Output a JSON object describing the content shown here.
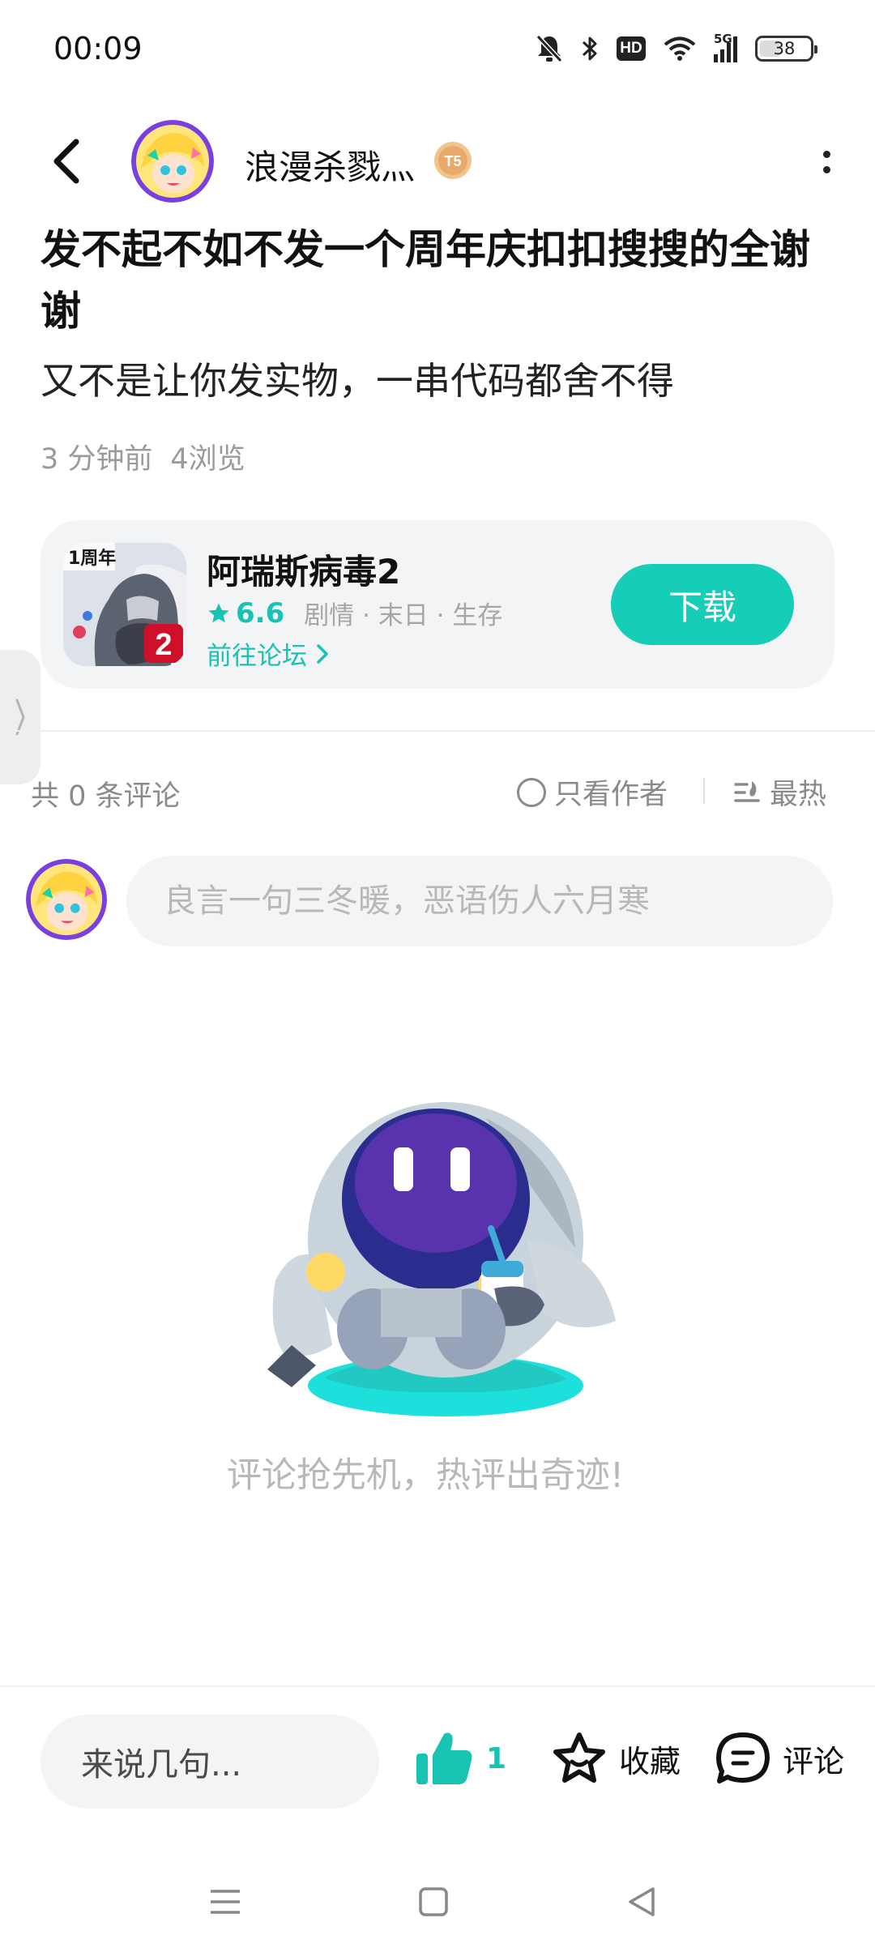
{
  "status_bar": {
    "time": "00:09",
    "hd_label": "HD",
    "network_label": "5G",
    "battery": "38"
  },
  "header": {
    "author_name": "浪漫杀戮灬",
    "level_badge": "T5"
  },
  "post": {
    "title": "发不起不如不发一个周年庆扣扣搜搜的全谢谢",
    "body": "又不是让你发实物，一串代码都舍不得",
    "time_ago": "3 分钟前",
    "views": "4浏览"
  },
  "game_card": {
    "name": "阿瑞斯病毒2",
    "rating": "6.6",
    "tags": "剧情 · 末日 · 生存",
    "forum_link": "前往论坛",
    "download_label": "下载",
    "icon_badge_text": "1周年",
    "icon_number": "2"
  },
  "comments": {
    "count_label": "共 0 条评论",
    "author_only_label": "只看作者",
    "sort_label": "最热",
    "input_placeholder": "良言一句三冬暖，恶语伤人六月寒",
    "empty_text": "评论抢先机，热评出奇迹!"
  },
  "bottom_bar": {
    "quick_reply_placeholder": "来说几句...",
    "like_count": "1",
    "favorite_label": "收藏",
    "comment_label": "评论"
  },
  "colors": {
    "accent": "#16cdb8",
    "card_bg": "#f3f4f6",
    "muted_text": "#9a9a9a"
  },
  "icons": {
    "back": "chevron-left-icon",
    "more": "more-vertical-icon",
    "like": "thumbs-up-icon",
    "favorite": "star-icon",
    "comment": "chat-bubble-icon"
  }
}
